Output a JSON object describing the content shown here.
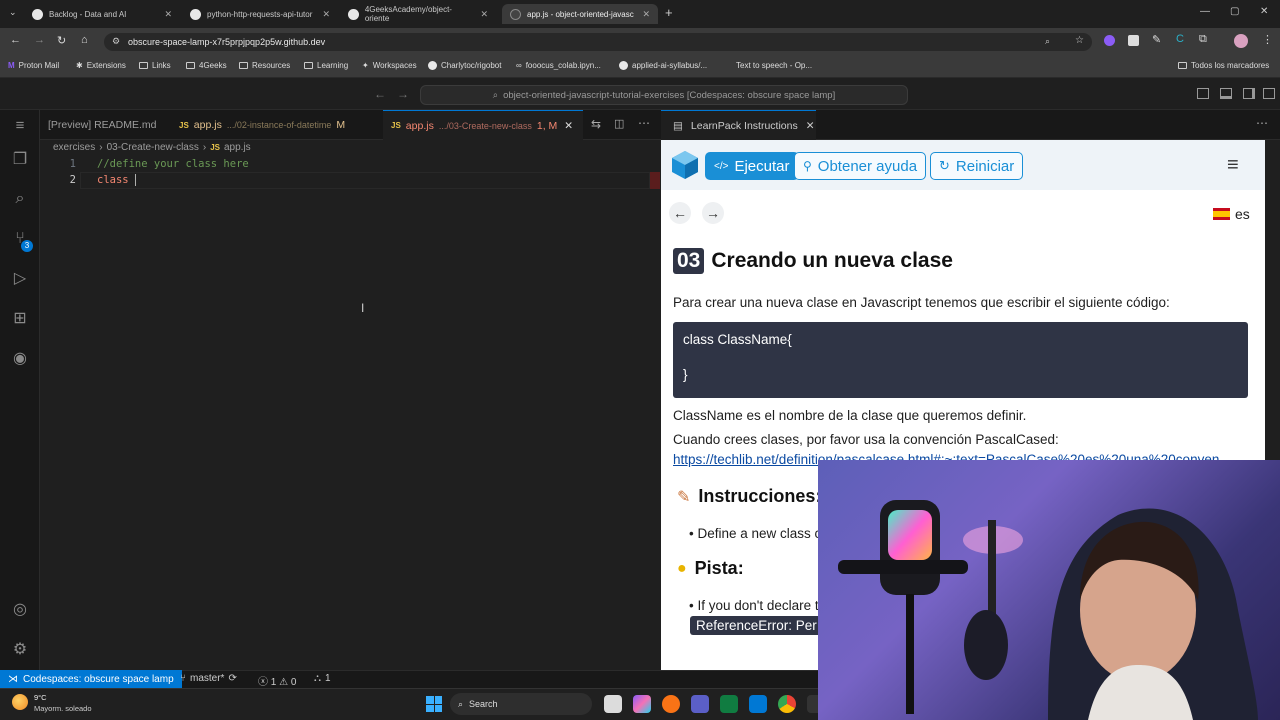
{
  "browser": {
    "tabs": [
      {
        "title": "Backlog - Data and AI"
      },
      {
        "title": "python-http-requests-api-tutor"
      },
      {
        "title": "4GeeksAcademy/object-oriente"
      },
      {
        "title": "app.js - object-oriented-javasc"
      }
    ],
    "url": "obscure-space-lamp-x7r5prpjpqp2p5w.github.dev",
    "bookmarks": [
      "Proton Mail",
      "Extensions",
      "Links",
      "4Geeks",
      "Resources",
      "Learning",
      "Workspaces",
      "Charlytoc/rigobot",
      "fooocus_colab.ipyn...",
      "applied-ai-syllabus/...",
      "Text to speech - Op..."
    ],
    "all_bookmarks": "Todos los marcadores"
  },
  "vscode": {
    "command_center": "object-oriented-javascript-tutorial-exercises [Codespaces: obscure space lamp]",
    "tabs": [
      {
        "label": "[Preview] README.md"
      },
      {
        "label": "app.js",
        "path": ".../02-instance-of-datetime",
        "badge": "M"
      },
      {
        "label": "app.js",
        "path": ".../03-Create-new-class",
        "badge": "1, M"
      }
    ],
    "breadcrumb": [
      "exercises",
      "03-Create-new-class",
      "app.js"
    ],
    "code": [
      {
        "num": "1",
        "text": "//define your class here"
      },
      {
        "num": "2",
        "text": "class "
      }
    ],
    "source_control_badge": "3",
    "panel_tab": "LearnPack Instructions",
    "status": {
      "remote": "Codespaces: obscure space lamp",
      "branch": "master*",
      "problems": "ⓧ 1 ⚠ 0",
      "ports": "1"
    }
  },
  "learnpack": {
    "buttons": {
      "run": "Ejecutar",
      "help": "Obtener ayuda",
      "reset": "Reiniciar"
    },
    "lang": "es",
    "exercise_number": "03",
    "title": "Creando un nueva clase",
    "intro": "Para crear una nueva clase en Javascript tenemos que escribir el siguiente código:",
    "code_line1": "class ClassName{",
    "code_line2": "}",
    "para1": "ClassName es el nombre de la clase que queremos definir.",
    "para2": "Cuando crees clases, por favor usa la convención PascalCased:",
    "link": "https://techlib.net/definition/pascalcase.html#:~:text=PascalCase%20es%20una%20conven",
    "instructions_heading": "Instrucciones:",
    "instruction1": "Define a new class c",
    "hint_heading": "Pista:",
    "hint1": "If you don't declare t",
    "hint_code": "ReferenceError: Per"
  },
  "taskbar": {
    "weather_temp": "9°C",
    "weather_desc": "Mayorm. soleado",
    "search": "Search"
  }
}
